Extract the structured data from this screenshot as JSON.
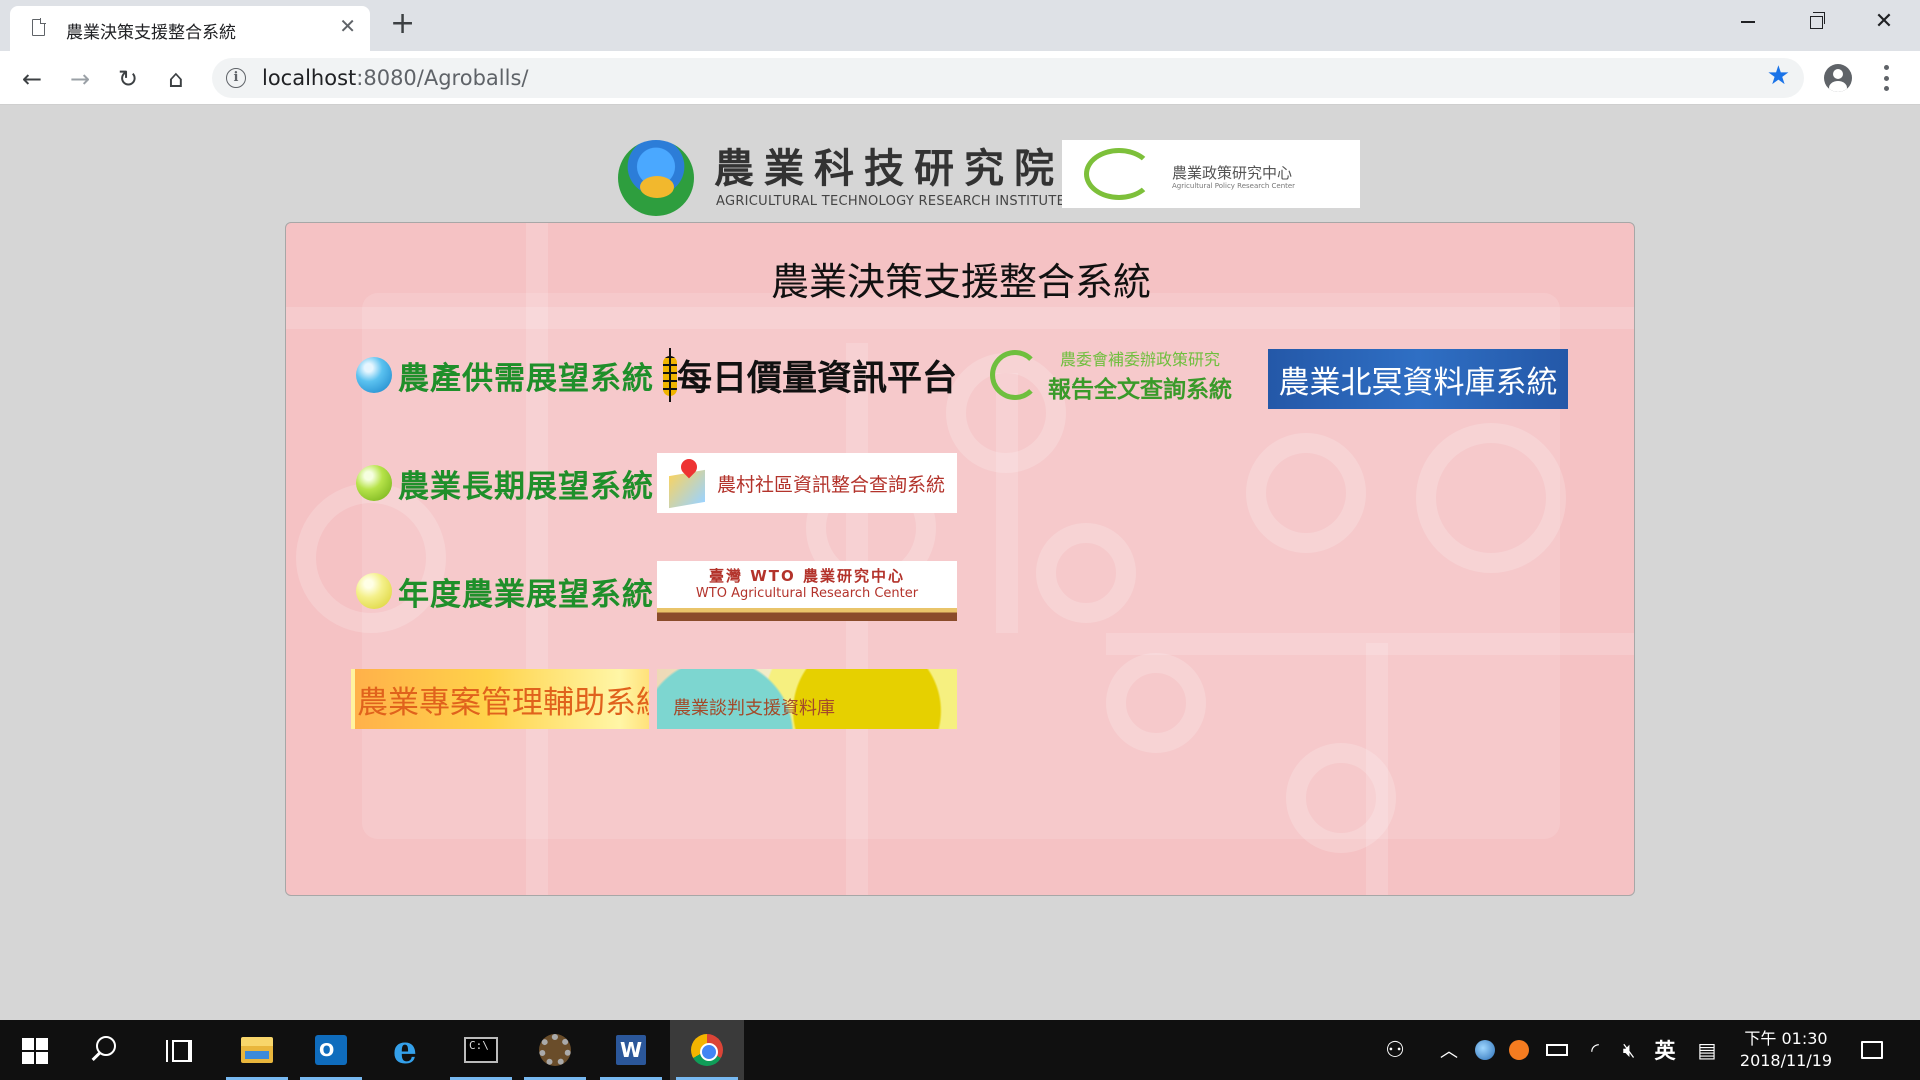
{
  "browser": {
    "tab_title": "農業決策支援整合系統",
    "tab_close": "✕",
    "new_tab": "+",
    "url_host": "localhost",
    "url_rest": ":8080/Agroballs/"
  },
  "header": {
    "ari_name": "農業科技研究院",
    "ari_english": "AGRICULTURAL TECHNOLOGY RESEARCH INSTITUTE",
    "aprc_name": "農業政策研究中心",
    "aprc_english": "Agricultural Policy Research Center"
  },
  "panel": {
    "title": "農業決策支援整合系統"
  },
  "systems": {
    "supply_demand": "農產供需展望系統",
    "long_term": "農業長期展望系統",
    "annual": "年度農業展望系統"
  },
  "banners": {
    "daily_price": "每日價量資訊平台",
    "report_top": "農委會補委辦政策研究",
    "report_main": "報告全文查詢系統",
    "beiming": "農業北冥資料庫系統",
    "rural": "農村社區資訊整合查詢系統",
    "wto_zh": "臺灣 WTO 農業研究中心",
    "wto_en": "WTO Agricultural Research Center",
    "project": "農業專案管理輔助系統",
    "negotiation": "農業談判支援資料庫"
  },
  "taskbar": {
    "outlook_letter": "O",
    "word_letter": "W",
    "cmd_text": "C:\\",
    "ie_letter": "e",
    "ime": "英",
    "time": "下午 01:30",
    "date": "2018/11/19"
  },
  "colors": {
    "panel_bg": "#f5c2c4",
    "system_green": "#1f8f2a",
    "accent_blue": "#1a73e8"
  }
}
